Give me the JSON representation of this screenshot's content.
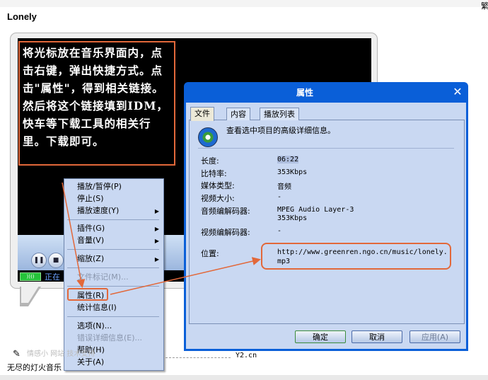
{
  "page": {
    "song_title": "Lonely",
    "corner_glyph": "繁"
  },
  "player": {
    "caption": "将光标放在音乐界面内，点击右键，弹出快捷方式。点击\"属性\"，得到相关链接。然后将这个链接填到IDM，快车等下载工具的相关行里。下载即可。",
    "status_text": "正在",
    "signal_label": "))))"
  },
  "context_menu": {
    "items": [
      {
        "label": "播放/暂停(P)",
        "disabled": false,
        "submenu": false
      },
      {
        "label": "停止(S)",
        "disabled": false,
        "submenu": false
      },
      {
        "label": "播放速度(Y)",
        "disabled": false,
        "submenu": true
      },
      {
        "label": "插件(G)",
        "disabled": false,
        "submenu": true
      },
      {
        "label": "音量(V)",
        "disabled": false,
        "submenu": true
      },
      {
        "label": "缩放(Z)",
        "disabled": false,
        "submenu": true
      },
      {
        "label": "文件标记(M)...",
        "disabled": true,
        "submenu": false
      },
      {
        "label": "属性(R)",
        "disabled": false,
        "submenu": false
      },
      {
        "label": "统计信息(I)",
        "disabled": false,
        "submenu": false
      },
      {
        "label": "选项(N)...",
        "disabled": false,
        "submenu": false
      },
      {
        "label": "错误详细信息(E)...",
        "disabled": true,
        "submenu": false
      },
      {
        "label": "帮助(H)",
        "disabled": false,
        "submenu": false
      },
      {
        "label": "关于(A)",
        "disabled": false,
        "submenu": false
      }
    ]
  },
  "dialog": {
    "title": "属性",
    "close_glyph": "✕",
    "tabs": [
      "文件",
      "内容",
      "播放列表"
    ],
    "description": "查看选中项目的高级详细信息。",
    "properties": [
      {
        "label": "长度:",
        "value": "06:22"
      },
      {
        "label": "比特率:",
        "value": "353Kbps"
      },
      {
        "label": "媒体类型:",
        "value": "音频"
      },
      {
        "label": "视频大小:",
        "value": "-"
      },
      {
        "label": "音频编解码器:",
        "value": "MPEG Audio Layer-3"
      },
      {
        "label": "",
        "value": "353Kbps"
      },
      {
        "label": "视频编解码器:",
        "value": "-"
      }
    ],
    "location_label": "位置:",
    "location_value": "http://www.greenren.ngo.cn/music/lonely.mp3",
    "buttons": {
      "ok": "确定",
      "cancel": "取消",
      "apply": "应用(A)"
    }
  },
  "footer": {
    "faded_text": "情感小  网站  技术支持",
    "code": "Y2.cn",
    "text": "无尽的灯火音乐"
  },
  "colors": {
    "annotation": "#e2683a",
    "title_bar": "#0a5fd8",
    "dialog_bg": "#c9d8f2"
  },
  "icons": {
    "move": "move-cursor-icon",
    "media": "media-player-icon",
    "pencil": "pencil-icon"
  }
}
